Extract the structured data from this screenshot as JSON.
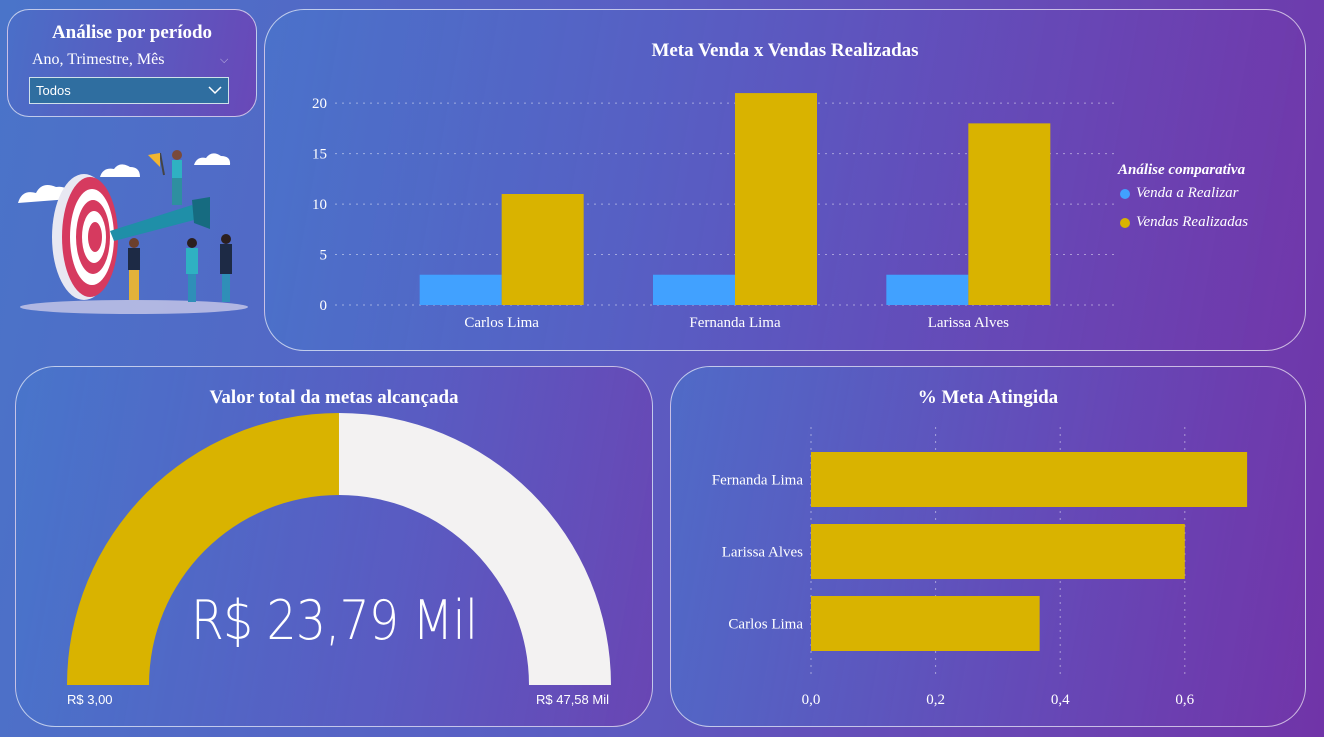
{
  "filter": {
    "title": "Análise por período",
    "subtitle": "Ano, Trimestre, Mês",
    "dropdown_value": "Todos"
  },
  "colors": {
    "gold": "#d9b300",
    "blue": "#41a1ff",
    "gauge_rest": "#f3f2f2"
  },
  "illustration": {
    "icon": "target-goal-team-illustration"
  },
  "bar_chart": {
    "title": "Meta Venda x Vendas Realizadas",
    "legend_title": "Análise comparativa",
    "legend_items": [
      "Venda a Realizar",
      "Vendas Realizadas"
    ]
  },
  "gauge": {
    "title": "Valor total da metas alcançada",
    "value_label": "R$ 23,79 Mil",
    "min_label": "R$ 3,00",
    "max_label": "R$ 47,58 Mil",
    "min": 3,
    "max": 47580,
    "value": 23790
  },
  "pct_chart": {
    "title": "% Meta Atingida"
  },
  "chart_data": [
    {
      "type": "bar",
      "title": "Meta Venda x Vendas Realizadas",
      "categories": [
        "Carlos Lima",
        "Fernanda Lima",
        "Larissa Alves"
      ],
      "series": [
        {
          "name": "Venda a Realizar",
          "values": [
            3,
            3,
            3
          ]
        },
        {
          "name": "Vendas Realizadas",
          "values": [
            11,
            21,
            18
          ]
        }
      ],
      "yticks": [
        "0",
        "5",
        "10",
        "15",
        "20"
      ],
      "ylim": [
        0,
        22
      ],
      "grid": true,
      "legend": "right"
    },
    {
      "type": "bar",
      "orientation": "horizontal",
      "title": "% Meta Atingida",
      "categories": [
        "Fernanda Lima",
        "Larissa Alves",
        "Carlos Lima"
      ],
      "values": [
        0.7,
        0.6,
        0.367
      ],
      "xticks": [
        "0,0",
        "0,2",
        "0,4",
        "0,6"
      ],
      "xlim": [
        0,
        0.72
      ],
      "grid": true
    }
  ]
}
